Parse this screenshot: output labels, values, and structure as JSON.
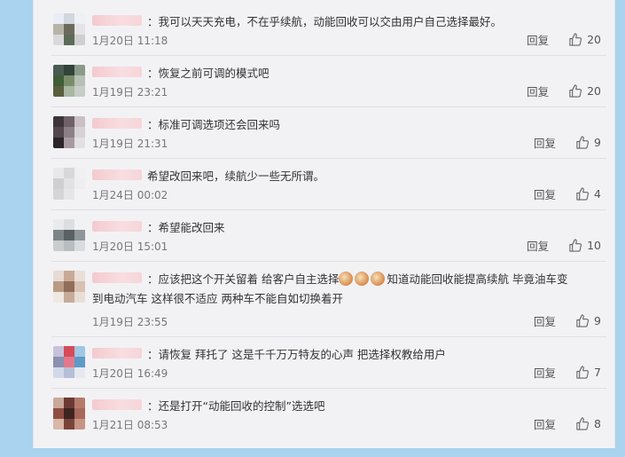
{
  "comments": [
    {
      "text": "：我可以天天充电，不在乎续航，动能回收可以交由用户自己选择最好。",
      "time": "1月20日 11:18",
      "reply": "回复",
      "likes": "20",
      "avatar": [
        "#e9edf5",
        "#d2d6df",
        "#eef0f4",
        "#b7b3a7",
        "#6b6a5d",
        "#e4e4e6",
        "#d9d9db",
        "#5b6b57",
        "#cfcfcf"
      ]
    },
    {
      "text": "：恢复之前可调的模式吧",
      "time": "1月19日 23:21",
      "reply": "回复",
      "likes": "20",
      "avatar": [
        "#4b5a52",
        "#32433a",
        "#8b9a88",
        "#3f5d36",
        "#7a8d6a",
        "#b7c0b5",
        "#5a5f3e",
        "#a8b7a1",
        "#c8cdc7"
      ]
    },
    {
      "text": "：标准可调选项还会回来吗",
      "time": "1月19日 21:31",
      "reply": "回复",
      "likes": "9",
      "avatar": [
        "#3d3439",
        "#6f6168",
        "#c9bfc4",
        "#52474c",
        "#8d7f86",
        "#d6d1d4",
        "#2c2528",
        "#a79aa0",
        "#e2e0e1"
      ]
    },
    {
      "text": "希望改回来吧，续航少一些无所谓。",
      "time": "1月24日 00:02",
      "reply": "回复",
      "likes": "4",
      "avatar": [
        "#e8e8ea",
        "#d8d8dc",
        "#f0f0f2",
        "#cfcfd3",
        "#e2e2e5",
        "#eeeef0",
        "#d5d5d8",
        "#e6e6e8",
        "#f2f2f4"
      ]
    },
    {
      "text": "：希望能改回来",
      "time": "1月20日 15:01",
      "reply": "回复",
      "likes": "10",
      "avatar": [
        "#e8eaec",
        "#dcdfe2",
        "#f1f2f4",
        "#7d8487",
        "#596164",
        "#8f969a",
        "#c9cdd0",
        "#b8bdc0",
        "#dadde0"
      ]
    },
    {
      "text": "：应该把这个开关留着 给客户自主选择",
      "text2": "知道动能回收能提高续航  毕竟油车变",
      "line2": "到电动汽车 这样很不适应  两种车不能自如切换着开",
      "time": "1月19日 23:55",
      "reply": "回复",
      "likes": "9",
      "avatar": [
        "#e7dbd3",
        "#c9a996",
        "#eadfd8",
        "#b99a84",
        "#8f6d58",
        "#d8c1b2",
        "#f0e8e3",
        "#c7ab99",
        "#e9ded7"
      ]
    },
    {
      "text": "：请恢复 拜托了 这是千千万万特友的心声 把选择权教给用户",
      "time": "1月20日 16:49",
      "reply": "回复",
      "likes": "7",
      "avatar": [
        "#c7c2d9",
        "#d64b5a",
        "#9fc7e2",
        "#8b8fb0",
        "#e3788a",
        "#5c9ac8",
        "#d3d8e8",
        "#b6bfd8",
        "#e6e8f0"
      ]
    },
    {
      "text": "：还是打开“动能回收的控制”选选吧",
      "time": "1月21日 08:53",
      "reply": "回复",
      "likes": "8",
      "avatar": [
        "#c9a99a",
        "#6b3b33",
        "#b57b6a",
        "#8e4e42",
        "#3d2421",
        "#a8675a",
        "#d9b7a9",
        "#7a4439",
        "#c79385"
      ]
    }
  ]
}
